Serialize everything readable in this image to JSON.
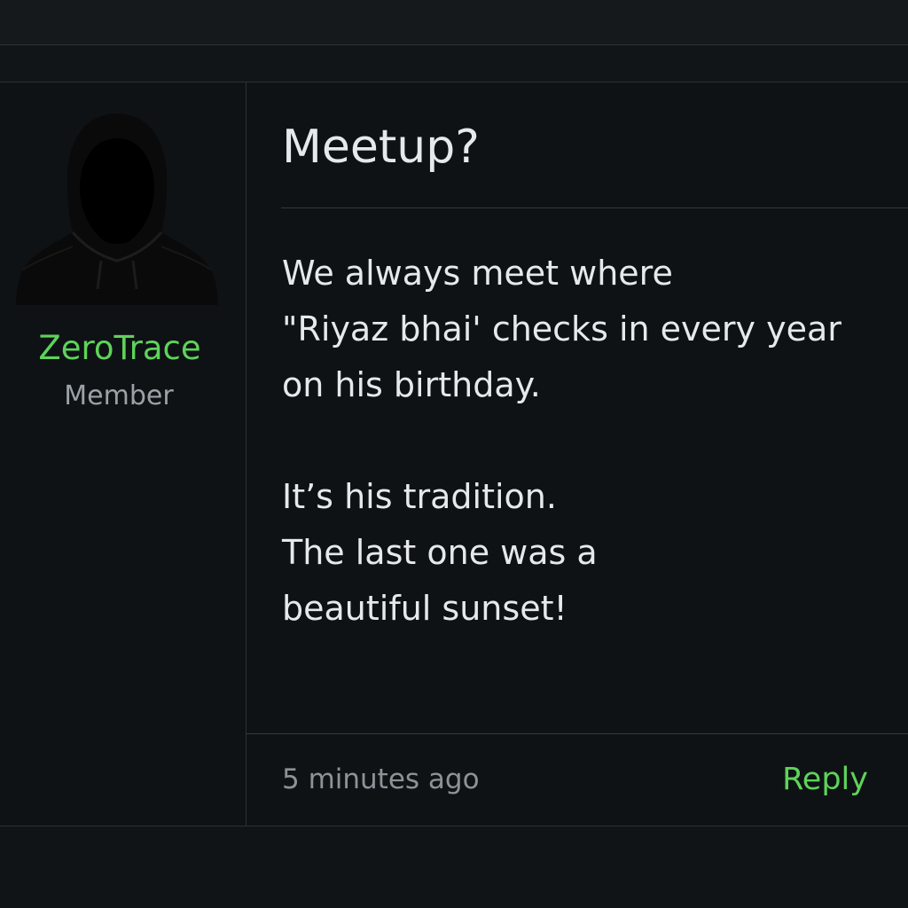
{
  "post": {
    "author": {
      "username": "ZeroTrace",
      "role": "Member",
      "avatar_icon": "hooded-figure-icon"
    },
    "title": "Meetup?",
    "body_lines": [
      "We always meet where",
      "\"Riyaz bhai' checks in every year",
      "on his birthday.",
      "",
      "It’s his tradition.",
      "The last one was a",
      "beautiful sunset!"
    ],
    "timestamp": "5 minutes ago",
    "reply_label": "Reply"
  },
  "colors": {
    "background": "#111417",
    "accent": "#5ed35a",
    "text": "#e6e9ec",
    "muted": "#8c9298",
    "divider": "#2c3135"
  }
}
